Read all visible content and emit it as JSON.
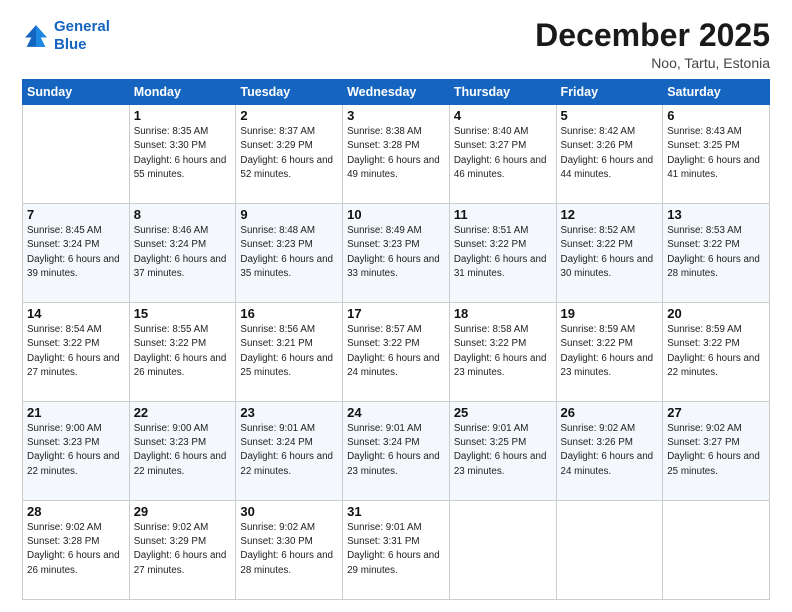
{
  "header": {
    "logo_line1": "General",
    "logo_line2": "Blue",
    "month": "December 2025",
    "location": "Noo, Tartu, Estonia"
  },
  "weekdays": [
    "Sunday",
    "Monday",
    "Tuesday",
    "Wednesday",
    "Thursday",
    "Friday",
    "Saturday"
  ],
  "weeks": [
    [
      {
        "day": "",
        "sunrise": "",
        "sunset": "",
        "daylight": ""
      },
      {
        "day": "1",
        "sunrise": "Sunrise: 8:35 AM",
        "sunset": "Sunset: 3:30 PM",
        "daylight": "Daylight: 6 hours and 55 minutes."
      },
      {
        "day": "2",
        "sunrise": "Sunrise: 8:37 AM",
        "sunset": "Sunset: 3:29 PM",
        "daylight": "Daylight: 6 hours and 52 minutes."
      },
      {
        "day": "3",
        "sunrise": "Sunrise: 8:38 AM",
        "sunset": "Sunset: 3:28 PM",
        "daylight": "Daylight: 6 hours and 49 minutes."
      },
      {
        "day": "4",
        "sunrise": "Sunrise: 8:40 AM",
        "sunset": "Sunset: 3:27 PM",
        "daylight": "Daylight: 6 hours and 46 minutes."
      },
      {
        "day": "5",
        "sunrise": "Sunrise: 8:42 AM",
        "sunset": "Sunset: 3:26 PM",
        "daylight": "Daylight: 6 hours and 44 minutes."
      },
      {
        "day": "6",
        "sunrise": "Sunrise: 8:43 AM",
        "sunset": "Sunset: 3:25 PM",
        "daylight": "Daylight: 6 hours and 41 minutes."
      }
    ],
    [
      {
        "day": "7",
        "sunrise": "Sunrise: 8:45 AM",
        "sunset": "Sunset: 3:24 PM",
        "daylight": "Daylight: 6 hours and 39 minutes."
      },
      {
        "day": "8",
        "sunrise": "Sunrise: 8:46 AM",
        "sunset": "Sunset: 3:24 PM",
        "daylight": "Daylight: 6 hours and 37 minutes."
      },
      {
        "day": "9",
        "sunrise": "Sunrise: 8:48 AM",
        "sunset": "Sunset: 3:23 PM",
        "daylight": "Daylight: 6 hours and 35 minutes."
      },
      {
        "day": "10",
        "sunrise": "Sunrise: 8:49 AM",
        "sunset": "Sunset: 3:23 PM",
        "daylight": "Daylight: 6 hours and 33 minutes."
      },
      {
        "day": "11",
        "sunrise": "Sunrise: 8:51 AM",
        "sunset": "Sunset: 3:22 PM",
        "daylight": "Daylight: 6 hours and 31 minutes."
      },
      {
        "day": "12",
        "sunrise": "Sunrise: 8:52 AM",
        "sunset": "Sunset: 3:22 PM",
        "daylight": "Daylight: 6 hours and 30 minutes."
      },
      {
        "day": "13",
        "sunrise": "Sunrise: 8:53 AM",
        "sunset": "Sunset: 3:22 PM",
        "daylight": "Daylight: 6 hours and 28 minutes."
      }
    ],
    [
      {
        "day": "14",
        "sunrise": "Sunrise: 8:54 AM",
        "sunset": "Sunset: 3:22 PM",
        "daylight": "Daylight: 6 hours and 27 minutes."
      },
      {
        "day": "15",
        "sunrise": "Sunrise: 8:55 AM",
        "sunset": "Sunset: 3:22 PM",
        "daylight": "Daylight: 6 hours and 26 minutes."
      },
      {
        "day": "16",
        "sunrise": "Sunrise: 8:56 AM",
        "sunset": "Sunset: 3:21 PM",
        "daylight": "Daylight: 6 hours and 25 minutes."
      },
      {
        "day": "17",
        "sunrise": "Sunrise: 8:57 AM",
        "sunset": "Sunset: 3:22 PM",
        "daylight": "Daylight: 6 hours and 24 minutes."
      },
      {
        "day": "18",
        "sunrise": "Sunrise: 8:58 AM",
        "sunset": "Sunset: 3:22 PM",
        "daylight": "Daylight: 6 hours and 23 minutes."
      },
      {
        "day": "19",
        "sunrise": "Sunrise: 8:59 AM",
        "sunset": "Sunset: 3:22 PM",
        "daylight": "Daylight: 6 hours and 23 minutes."
      },
      {
        "day": "20",
        "sunrise": "Sunrise: 8:59 AM",
        "sunset": "Sunset: 3:22 PM",
        "daylight": "Daylight: 6 hours and 22 minutes."
      }
    ],
    [
      {
        "day": "21",
        "sunrise": "Sunrise: 9:00 AM",
        "sunset": "Sunset: 3:23 PM",
        "daylight": "Daylight: 6 hours and 22 minutes."
      },
      {
        "day": "22",
        "sunrise": "Sunrise: 9:00 AM",
        "sunset": "Sunset: 3:23 PM",
        "daylight": "Daylight: 6 hours and 22 minutes."
      },
      {
        "day": "23",
        "sunrise": "Sunrise: 9:01 AM",
        "sunset": "Sunset: 3:24 PM",
        "daylight": "Daylight: 6 hours and 22 minutes."
      },
      {
        "day": "24",
        "sunrise": "Sunrise: 9:01 AM",
        "sunset": "Sunset: 3:24 PM",
        "daylight": "Daylight: 6 hours and 23 minutes."
      },
      {
        "day": "25",
        "sunrise": "Sunrise: 9:01 AM",
        "sunset": "Sunset: 3:25 PM",
        "daylight": "Daylight: 6 hours and 23 minutes."
      },
      {
        "day": "26",
        "sunrise": "Sunrise: 9:02 AM",
        "sunset": "Sunset: 3:26 PM",
        "daylight": "Daylight: 6 hours and 24 minutes."
      },
      {
        "day": "27",
        "sunrise": "Sunrise: 9:02 AM",
        "sunset": "Sunset: 3:27 PM",
        "daylight": "Daylight: 6 hours and 25 minutes."
      }
    ],
    [
      {
        "day": "28",
        "sunrise": "Sunrise: 9:02 AM",
        "sunset": "Sunset: 3:28 PM",
        "daylight": "Daylight: 6 hours and 26 minutes."
      },
      {
        "day": "29",
        "sunrise": "Sunrise: 9:02 AM",
        "sunset": "Sunset: 3:29 PM",
        "daylight": "Daylight: 6 hours and 27 minutes."
      },
      {
        "day": "30",
        "sunrise": "Sunrise: 9:02 AM",
        "sunset": "Sunset: 3:30 PM",
        "daylight": "Daylight: 6 hours and 28 minutes."
      },
      {
        "day": "31",
        "sunrise": "Sunrise: 9:01 AM",
        "sunset": "Sunset: 3:31 PM",
        "daylight": "Daylight: 6 hours and 29 minutes."
      },
      {
        "day": "",
        "sunrise": "",
        "sunset": "",
        "daylight": ""
      },
      {
        "day": "",
        "sunrise": "",
        "sunset": "",
        "daylight": ""
      },
      {
        "day": "",
        "sunrise": "",
        "sunset": "",
        "daylight": ""
      }
    ]
  ]
}
